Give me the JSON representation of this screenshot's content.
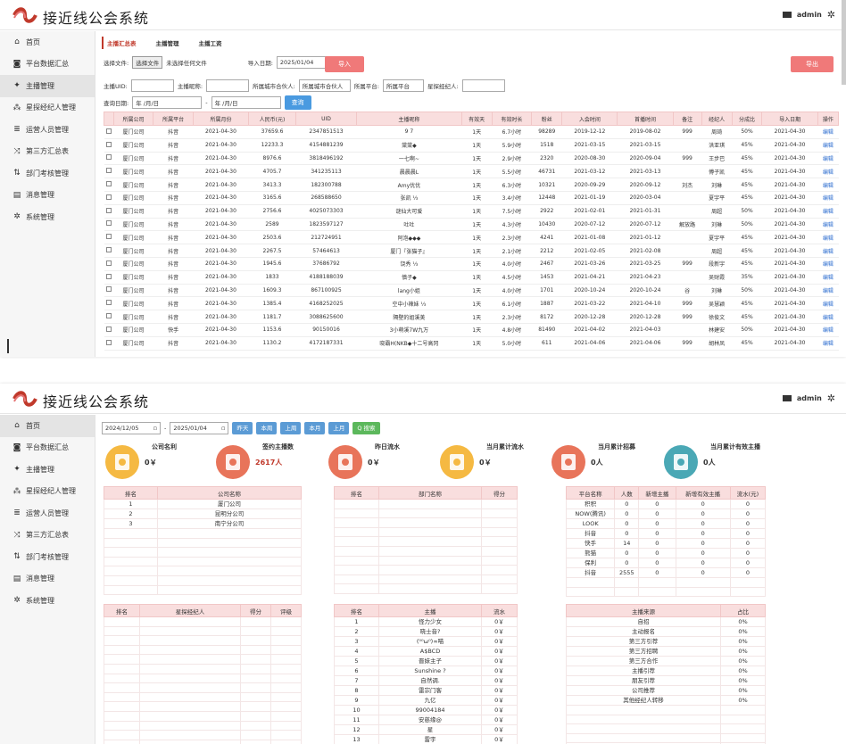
{
  "app": {
    "title": "接近线公会系统",
    "user": "admin"
  },
  "sidebar": {
    "items": [
      {
        "label": "首页",
        "icon": "home-icon",
        "glyph": "⌂"
      },
      {
        "label": "平台数据汇总",
        "icon": "chart-icon",
        "glyph": "◙"
      },
      {
        "label": "主播管理",
        "icon": "users-icon",
        "glyph": "✦"
      },
      {
        "label": "星探经纪人管理",
        "icon": "network-icon",
        "glyph": "⁂"
      },
      {
        "label": "运营人员管理",
        "icon": "list-icon",
        "glyph": "≣"
      },
      {
        "label": "第三方汇总表",
        "icon": "shuffle-icon",
        "glyph": "⤨"
      },
      {
        "label": "部门考核管理",
        "icon": "sort-icon",
        "glyph": "⇅"
      },
      {
        "label": "消息管理",
        "icon": "message-icon",
        "glyph": "▤"
      },
      {
        "label": "系统管理",
        "icon": "gear-icon",
        "glyph": "✲"
      }
    ]
  },
  "screen1": {
    "tabs": [
      "主播汇总表",
      "主播管理",
      "主播工资"
    ],
    "file_label": "选择文件:",
    "file_button": "选择文件",
    "file_status": "未选择任何文件",
    "import_date_label": "导入日期:",
    "import_date": "2025/01/04",
    "import_button": "导入",
    "export_button": "导出",
    "filters": {
      "uid_label": "主播UID:",
      "name_label": "主播昵称:",
      "partner_label": "所属城市合伙人:",
      "partner_value": "所属城市合伙人",
      "platform_label": "所属平台:",
      "platform_value": "所属平台",
      "agent_label": "星探经纪人:"
    },
    "query_date_label": "查询日期:",
    "date_placeholder": "年 /月/日",
    "query_button": "查询",
    "columns": [
      "",
      "所属公司",
      "所属平台",
      "所属月份",
      "人民币(元)",
      "UID",
      "主播昵称",
      "有效天",
      "有效时长",
      "粉丝",
      "入会时间",
      "首播时间",
      "备注",
      "经纪人",
      "分成比",
      "导入日期",
      "操作"
    ],
    "rows": [
      [
        "厦门公司",
        "抖音",
        "2021-04-30",
        "37659.6",
        "2347851513",
        "9 7",
        "1天",
        "6.7小时",
        "98289",
        "2019-12-12",
        "2019-08-02",
        "999",
        "周琦",
        "50%",
        "2021-04-30",
        "编辑"
      ],
      [
        "厦门公司",
        "抖音",
        "2021-04-30",
        "12233.3",
        "4154881239",
        "棠棠◆",
        "1天",
        "5.9小时",
        "1518",
        "2021-03-15",
        "2021-03-15",
        "",
        "洪亚琪",
        "45%",
        "2021-04-30",
        "编辑"
      ],
      [
        "厦门公司",
        "抖音",
        "2021-04-30",
        "8976.6",
        "3818496192",
        "一七啊~",
        "1天",
        "2.9小时",
        "2320",
        "2020-08-30",
        "2020-09-04",
        "999",
        "王步巴",
        "45%",
        "2021-04-30",
        "编辑"
      ],
      [
        "厦门公司",
        "抖音",
        "2021-04-30",
        "4705.7",
        "341235113",
        "晨晨晨L",
        "1天",
        "5.5小时",
        "46731",
        "2021-03-12",
        "2021-03-13",
        "",
        "傅子凯",
        "45%",
        "2021-04-30",
        "编辑"
      ],
      [
        "厦门公司",
        "抖音",
        "2021-04-30",
        "3413.3",
        "182300788",
        "Amy优优",
        "1天",
        "6.3小时",
        "10321",
        "2020-09-29",
        "2020-09-12",
        "刘杰",
        "刘琳",
        "45%",
        "2021-04-30",
        "编辑"
      ],
      [
        "厦门公司",
        "抖音",
        "2021-04-30",
        "3165.6",
        "268588650",
        "张凯 ⅓",
        "1天",
        "3.4小时",
        "12448",
        "2021-01-19",
        "2020-03-04",
        "",
        "夏宇平",
        "45%",
        "2021-04-30",
        "编辑"
      ],
      [
        "厦门公司",
        "抖音",
        "2021-04-30",
        "2756.6",
        "4025073303",
        "谜仙大可爱",
        "1天",
        "7.5小时",
        "2922",
        "2021-02-01",
        "2021-01-31",
        "",
        "周超",
        "50%",
        "2021-04-30",
        "编辑"
      ],
      [
        "厦门公司",
        "抖音",
        "2021-04-30",
        "2589",
        "1823597127",
        "吐吐",
        "1天",
        "4.3小时",
        "10430",
        "2020-07-12",
        "2020-07-12",
        "解放路",
        "刘琳",
        "50%",
        "2021-04-30",
        "编辑"
      ],
      [
        "厦门公司",
        "抖音",
        "2021-04-30",
        "2503.6",
        "212724951",
        "阿泡◆◆◆",
        "1天",
        "2.3小时",
        "4241",
        "2021-01-08",
        "2021-01-12",
        "",
        "夏宇平",
        "45%",
        "2021-04-30",
        "编辑"
      ],
      [
        "厦门公司",
        "抖音",
        "2021-04-30",
        "2267.5",
        "57464613",
        "厦门『张猫子』",
        "1天",
        "2.1小时",
        "2212",
        "2021-02-05",
        "2021-02-08",
        "",
        "周超",
        "45%",
        "2021-04-30",
        "编辑"
      ],
      [
        "厦门公司",
        "抖音",
        "2021-04-30",
        "1945.6",
        "37686792",
        "饶秀 ⅓",
        "1天",
        "4.0小时",
        "2467",
        "2021-03-26",
        "2021-03-25",
        "999",
        "段新宇",
        "45%",
        "2021-04-30",
        "编辑"
      ],
      [
        "厦门公司",
        "抖音",
        "2021-04-30",
        "1833",
        "4188188039",
        "慎子◆",
        "1天",
        "4.5小时",
        "1453",
        "2021-04-21",
        "2021-04-23",
        "",
        "吴财霞",
        "35%",
        "2021-04-30",
        "编辑"
      ],
      [
        "厦门公司",
        "抖音",
        "2021-04-30",
        "1609.3",
        "867100925",
        "lang小姐",
        "1天",
        "4.0小时",
        "1701",
        "2020-10-24",
        "2020-10-24",
        "谷",
        "刘琳",
        "50%",
        "2021-04-30",
        "编辑"
      ],
      [
        "厦门公司",
        "抖音",
        "2021-04-30",
        "1385.4",
        "4168252025",
        "空中小辣妹 ⅓",
        "1天",
        "6.1小时",
        "1887",
        "2021-03-22",
        "2021-04-10",
        "999",
        "吴慧颖",
        "45%",
        "2021-04-30",
        "编辑"
      ],
      [
        "厦门公司",
        "抖音",
        "2021-04-30",
        "1181.7",
        "3088625600",
        "隔壁的姐溪美",
        "1天",
        "2.3小时",
        "8172",
        "2020-12-28",
        "2020-12-28",
        "999",
        "徐俊文",
        "45%",
        "2021-04-30",
        "编辑"
      ],
      [
        "厦门公司",
        "快手",
        "2021-04-30",
        "1153.6",
        "90150016",
        "3小萌溪7W九万",
        "1天",
        "4.8小时",
        "81490",
        "2021-04-02",
        "2021-04-03",
        "",
        "林建安",
        "50%",
        "2021-04-30",
        "编辑"
      ],
      [
        "厦门公司",
        "抖音",
        "2021-04-30",
        "1130.2",
        "4172187331",
        "晓霸H(NKB◆十二号高冈",
        "1天",
        "5.0小时",
        "611",
        "2021-04-06",
        "2021-04-06",
        "999",
        "胡林凤",
        "45%",
        "2021-04-30",
        "编辑"
      ]
    ]
  },
  "screen2": {
    "date_from": "2024/12/05",
    "date_to": "2025/01/04",
    "buttons": [
      "昨天",
      "本周",
      "上周",
      "本月",
      "上月"
    ],
    "search_button": "Q 搜索",
    "cards": [
      {
        "title": "公司名利",
        "value": "0￥",
        "color": "#f5b942",
        "icon": "magnifier-icon"
      },
      {
        "title": "签约主播数",
        "value": "2617人",
        "color": "#e8745a",
        "icon": "pie-icon",
        "red": true
      },
      {
        "title": "昨日流水",
        "value": "0￥",
        "color": "#e8745a",
        "icon": "bar-chart-icon"
      },
      {
        "title": "当月累计流水",
        "value": "0￥",
        "color": "#f5b942",
        "icon": "cycle-icon"
      },
      {
        "title": "当月累计招募",
        "value": "0人",
        "color": "#e8745a",
        "icon": "target-icon"
      },
      {
        "title": "当月累计有效主播",
        "value": "0人",
        "color": "#4aa8b5",
        "icon": "line-chart-icon"
      }
    ],
    "company_rank": {
      "cols": [
        "排名",
        "公司名称"
      ],
      "rows": [
        [
          "1",
          "厦门公司"
        ],
        [
          "2",
          "昆明分公司"
        ],
        [
          "3",
          "南宁分公司"
        ]
      ]
    },
    "dept_rank": {
      "cols": [
        "排名",
        "部门名称",
        "得分"
      ]
    },
    "platform": {
      "cols": [
        "平台名称",
        "人数",
        "新增主播",
        "新增有效主播",
        "流水(元)"
      ],
      "rows": [
        [
          "积积",
          "0",
          "0",
          "0",
          "0"
        ],
        [
          "NOW(腾讯)",
          "0",
          "0",
          "0",
          "0"
        ],
        [
          "LOOK",
          "0",
          "0",
          "0",
          "0"
        ],
        [
          "抖音",
          "0",
          "0",
          "0",
          "0"
        ],
        [
          "快手",
          "14",
          "0",
          "0",
          "0"
        ],
        [
          "熊猫",
          "0",
          "0",
          "0",
          "0"
        ],
        [
          "保利",
          "0",
          "0",
          "0",
          "0"
        ],
        [
          "抖音",
          "2555",
          "0",
          "0",
          "0"
        ]
      ]
    },
    "agent_rank": {
      "cols": [
        "排名",
        "星探经纪人",
        "得分",
        "评级"
      ]
    },
    "anchor_rank": {
      "cols": [
        "排名",
        "主播",
        "流水"
      ],
      "rows": [
        [
          "1",
          "怪力少女",
          "0￥"
        ],
        [
          "2",
          "晓士音?",
          "0￥"
        ],
        [
          "3",
          "(⁰⁰ω⁰)∞喵",
          "0￥"
        ],
        [
          "4",
          "A$BCD",
          "0￥"
        ],
        [
          "5",
          "晋妹主子",
          "0￥"
        ],
        [
          "6",
          "Sunshine ?",
          "0￥"
        ],
        [
          "7",
          "自然调.",
          "0￥"
        ],
        [
          "8",
          "雷宗门客",
          "0￥"
        ],
        [
          "9",
          "九亿",
          "0￥"
        ],
        [
          "10",
          "99004184",
          "0￥"
        ],
        [
          "11",
          "安慈缘@",
          "0￥"
        ],
        [
          "12",
          "星",
          "0￥"
        ],
        [
          "13",
          "雷宇",
          "0￥"
        ]
      ]
    },
    "source": {
      "cols": [
        "主播来源",
        "占比"
      ],
      "rows": [
        [
          "自招",
          "0%"
        ],
        [
          "主动报名",
          "0%"
        ],
        [
          "第三方引荐",
          "0%"
        ],
        [
          "第三方招聘",
          "0%"
        ],
        [
          "第三方合作",
          "0%"
        ],
        [
          "主播引荐",
          "0%"
        ],
        [
          "朋友引荐",
          "0%"
        ],
        [
          "公司推荐",
          "0%"
        ],
        [
          "其他经纪人转移",
          "0%"
        ]
      ]
    }
  }
}
